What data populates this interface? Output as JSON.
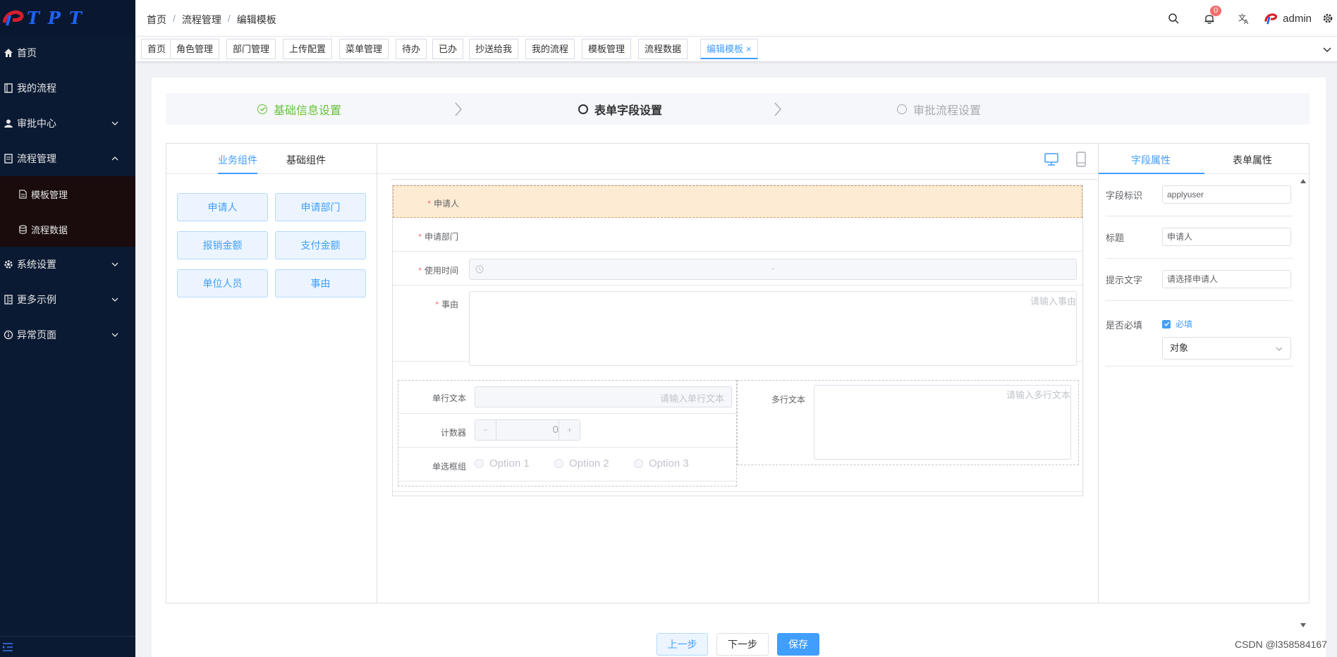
{
  "app": {
    "logo_text": "TPT"
  },
  "sidebar": {
    "items": [
      {
        "label": "首页",
        "icon": "home-icon"
      },
      {
        "label": "我的流程",
        "icon": "book-icon"
      },
      {
        "label": "审批中心",
        "icon": "user-icon",
        "expandable": true
      },
      {
        "label": "流程管理",
        "icon": "document-icon",
        "expanded": true
      },
      {
        "label": "系统设置",
        "icon": "gear-icon",
        "expandable": true
      },
      {
        "label": "更多示例",
        "icon": "list-icon",
        "expandable": true
      },
      {
        "label": "异常页面",
        "icon": "info-icon",
        "expandable": true
      }
    ],
    "submenu": [
      {
        "label": "模板管理",
        "icon": "file-icon"
      },
      {
        "label": "流程数据",
        "icon": "database-icon"
      }
    ]
  },
  "header": {
    "breadcrumb": [
      "首页",
      "流程管理",
      "编辑模板"
    ],
    "notification_count": "0",
    "user": "admin"
  },
  "tags": [
    {
      "label": "首页"
    },
    {
      "label": "角色管理"
    },
    {
      "label": "部门管理"
    },
    {
      "label": "上传配置"
    },
    {
      "label": "菜单管理"
    },
    {
      "label": "待办"
    },
    {
      "label": "已办"
    },
    {
      "label": "抄送给我"
    },
    {
      "label": "我的流程"
    },
    {
      "label": "模板管理"
    },
    {
      "label": "流程数据"
    },
    {
      "label": "编辑模板",
      "active": true,
      "close": "×"
    }
  ],
  "steps": [
    {
      "label": "基础信息设置",
      "status": "done"
    },
    {
      "label": "表单字段设置",
      "status": "current"
    },
    {
      "label": "审批流程设置",
      "status": "pending"
    }
  ],
  "left_panel": {
    "tabs": [
      "业务组件",
      "基础组件"
    ],
    "components": [
      "申请人",
      "申请部门",
      "报销金额",
      "支付金额",
      "单位人员",
      "事由"
    ]
  },
  "form": {
    "fields": {
      "applicant": {
        "label": "申请人",
        "required": "*"
      },
      "department": {
        "label": "申请部门",
        "required": "*"
      },
      "use_time": {
        "label": "使用时间",
        "required": "*",
        "separator": "-"
      },
      "reason": {
        "label": "事由",
        "required": "*",
        "placeholder": "请输入事由"
      }
    },
    "grid": {
      "single_text": {
        "label": "单行文本",
        "placeholder": "请输入单行文本"
      },
      "counter": {
        "label": "计数器",
        "value": "0",
        "minus": "−",
        "plus": "+"
      },
      "radio_group": {
        "label": "单选框组",
        "options": [
          "Option 1",
          "Option 2",
          "Option 3"
        ]
      },
      "multi_text": {
        "label": "多行文本",
        "placeholder": "请输入多行文本"
      }
    }
  },
  "right_panel": {
    "tabs": [
      "字段属性",
      "表单属性"
    ],
    "props": {
      "field_id": {
        "label": "字段标识",
        "value": "applyuser"
      },
      "title": {
        "label": "标题",
        "value": "申请人"
      },
      "hint": {
        "label": "提示文字",
        "value": "请选择申请人"
      },
      "required": {
        "label": "是否必填",
        "checkbox_label": "必填",
        "checked": true
      },
      "type_select": {
        "value": "对象"
      }
    }
  },
  "buttons": {
    "prev": "上一步",
    "next": "下一步",
    "save": "保存"
  },
  "watermark": "CSDN @l358584167",
  "colors": {
    "primary": "#409eff",
    "sidebar_bg": "#0b1a33",
    "success": "#67c23a",
    "danger": "#f56c6c",
    "selected_row": "#fdebd3"
  }
}
